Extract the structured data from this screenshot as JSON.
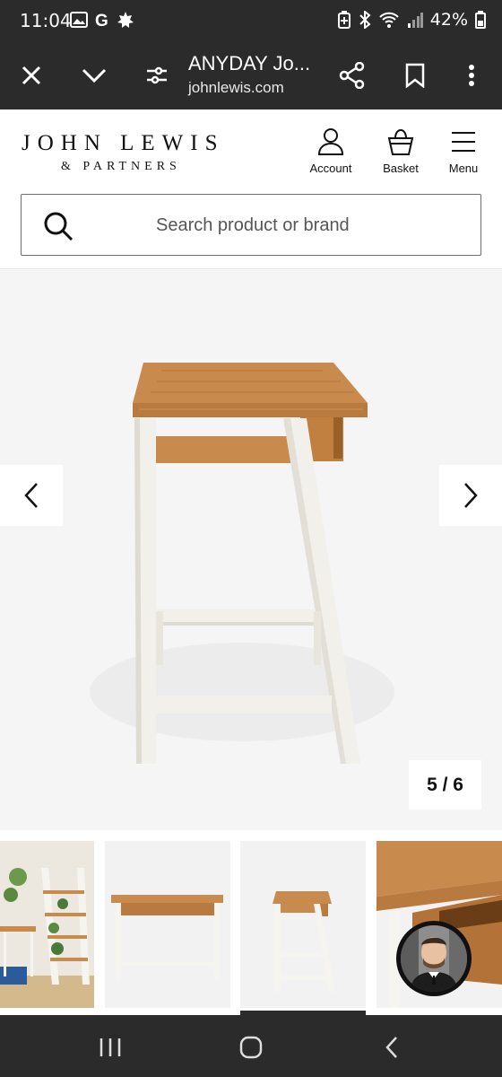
{
  "status_bar": {
    "time": "11:04",
    "left_icons": [
      "image-icon",
      "google-icon",
      "notification-icon"
    ],
    "right_icons": [
      "battery-saver-icon",
      "bluetooth-icon",
      "wifi-icon",
      "signal-icon"
    ],
    "battery": "42%"
  },
  "browser": {
    "title": "ANYDAY Jo...",
    "url": "johnlewis.com"
  },
  "header": {
    "logo_main": "JOHN LEWIS",
    "logo_sub": "& PARTNERS",
    "account_label": "Account",
    "basket_label": "Basket",
    "menu_label": "Menu",
    "search_placeholder": "Search product or brand"
  },
  "gallery": {
    "counter": "5 / 6"
  },
  "colors": {
    "dark_bar": "#2b2b2b",
    "oak": "#c98a4e",
    "white_frame": "#f2f0ea"
  }
}
